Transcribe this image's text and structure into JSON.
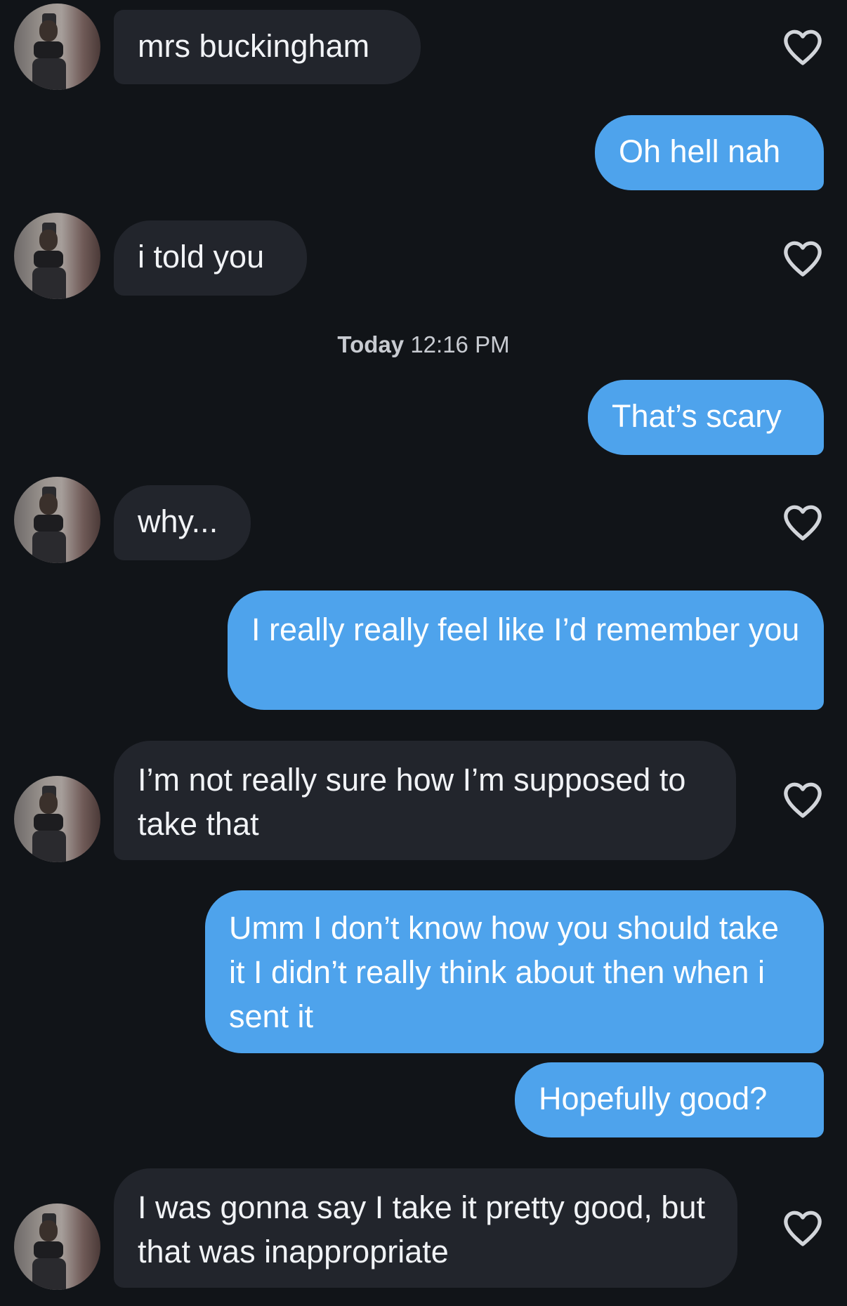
{
  "messages": [
    {
      "from": "them",
      "text": "mrs buckingham"
    },
    {
      "from": "me",
      "text": "Oh hell nah"
    },
    {
      "from": "them",
      "text": "i told you"
    },
    {
      "from": "me",
      "text": "That’s scary"
    },
    {
      "from": "them",
      "text": "why..."
    },
    {
      "from": "me",
      "text": "I really really feel like I’d remember you"
    },
    {
      "from": "them",
      "text": "I’m not really sure how I’m supposed to take that"
    },
    {
      "from": "me",
      "text": "Umm I don’t know how you should take it I didn’t really think about then when i sent it"
    },
    {
      "from": "me",
      "text": "Hopefully good?"
    },
    {
      "from": "them",
      "text": "I was gonna say I take it pretty good, but that was inappropriate"
    }
  ],
  "timestamp": {
    "day": "Today",
    "time": "12:16 PM"
  },
  "colors": {
    "background": "#111418",
    "incoming_bubble": "#22252c",
    "outgoing_bubble": "#4ea3ec"
  },
  "icons": {
    "like": "heart-outline-icon",
    "avatar": "profile-photo"
  }
}
